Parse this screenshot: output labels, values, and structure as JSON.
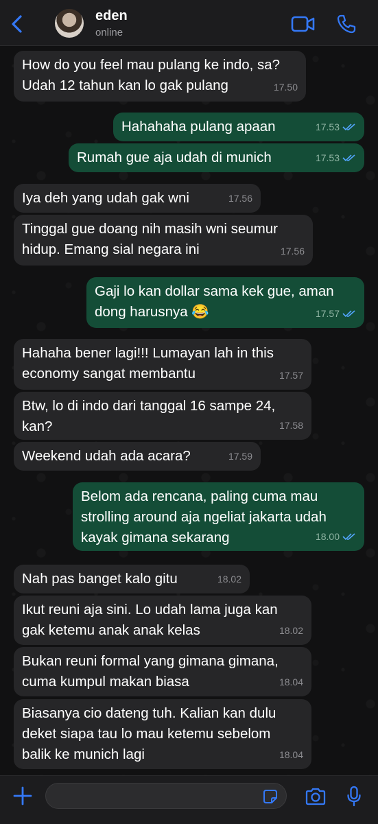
{
  "header": {
    "contact_name": "eden",
    "contact_status": "online"
  },
  "messages": [
    {
      "dir": "in",
      "text": "How do you feel mau pulang ke indo, sa?\nUdah 12 tahun kan lo gak pulang",
      "time": "17.50"
    },
    {
      "dir": "out",
      "text": "Hahahaha pulang apaan",
      "time": "17.53",
      "read": true
    },
    {
      "dir": "out",
      "text": "Rumah gue aja udah di munich",
      "time": "17.53",
      "read": true
    },
    {
      "dir": "in",
      "text": "Iya deh yang udah gak wni",
      "time": "17.56"
    },
    {
      "dir": "in",
      "text": "Tinggal gue doang nih masih wni seumur\nhidup. Emang sial negara ini",
      "time": "17.56"
    },
    {
      "dir": "out",
      "text": "Gaji lo kan dollar sama kek gue, aman\ndong harusnya 😂",
      "time": "17.57",
      "read": true
    },
    {
      "dir": "in",
      "text": "Hahaha bener lagi!!! Lumayan lah in this\neconomy sangat membantu",
      "time": "17.57"
    },
    {
      "dir": "in",
      "text": "Btw, lo di indo dari tanggal 16 sampe 24,\nkan?",
      "time": "17.58"
    },
    {
      "dir": "in",
      "text": "Weekend udah ada acara?",
      "time": "17.59"
    },
    {
      "dir": "out",
      "text": "Belom ada rencana, paling cuma mau\nstrolling around aja ngeliat jakarta udah\nkayak gimana sekarang",
      "time": "18.00",
      "read": true
    },
    {
      "dir": "in",
      "text": "Nah pas banget kalo gitu",
      "time": "18.02"
    },
    {
      "dir": "in",
      "text": "Ikut reuni aja sini. Lo udah lama juga kan\ngak ketemu anak anak kelas",
      "time": "18.02"
    },
    {
      "dir": "in",
      "text": "Bukan reuni formal yang gimana gimana,\ncuma kumpul makan biasa",
      "time": "18.04"
    },
    {
      "dir": "in",
      "text": "Biasanya cio dateng tuh. Kalian kan dulu\ndeket siapa tau lo mau ketemu sebelom\nbalik ke munich lagi",
      "time": "18.04"
    }
  ],
  "colors": {
    "incoming_bubble": "#262628",
    "outgoing_bubble": "#144d37",
    "accent": "#3478f6",
    "read_ticks": "#53a6ff"
  },
  "icons": {
    "back": "chevron-left-icon",
    "video": "video-call-icon",
    "call": "phone-icon",
    "plus": "plus-icon",
    "sticker": "sticker-icon",
    "camera": "camera-icon",
    "mic": "microphone-icon"
  }
}
